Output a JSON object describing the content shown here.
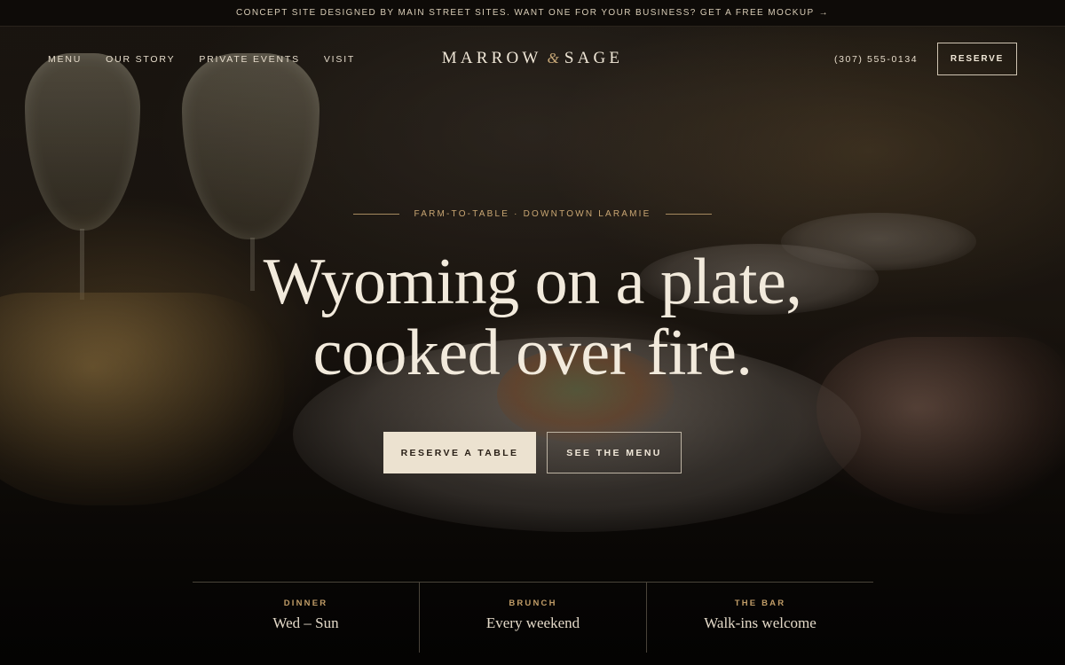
{
  "announcement": {
    "text": "CONCEPT SITE DESIGNED BY MAIN STREET SITES. WANT ONE FOR YOUR BUSINESS? GET A FREE MOCKUP",
    "arrow": "→"
  },
  "nav": {
    "links": [
      "MENU",
      "OUR STORY",
      "PRIVATE EVENTS",
      "VISIT"
    ],
    "logo_left": "MARROW",
    "logo_amp": "&",
    "logo_right": "SAGE",
    "phone": "(307) 555-0134",
    "reserve_label": "RESERVE"
  },
  "hero": {
    "eyebrow": "FARM-TO-TABLE · DOWNTOWN LARAMIE",
    "headline_line1": "Wyoming on a plate,",
    "headline_line2": "cooked over fire.",
    "primary_cta": "RESERVE A TABLE",
    "secondary_cta": "SEE THE MENU"
  },
  "hours": [
    {
      "label": "DINNER",
      "value": "Wed – Sun"
    },
    {
      "label": "BRUNCH",
      "value": "Every weekend"
    },
    {
      "label": "THE BAR",
      "value": "Walk-ins welcome"
    }
  ],
  "colors": {
    "accent_gold": "#c9a673",
    "cream_button": "#ece2d0",
    "background_dark": "#0c0906"
  },
  "icons": {
    "announcement_arrow": "arrow-right-icon"
  }
}
